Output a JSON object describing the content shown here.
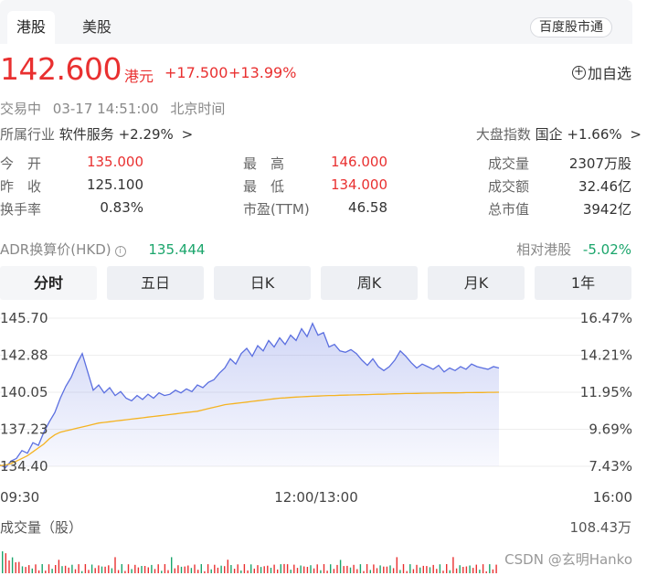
{
  "tabs": {
    "hk": "港股",
    "us": "美股",
    "market_link": "百度股市通"
  },
  "quote": {
    "price": "142.600",
    "currency": "港元",
    "change": "+17.500",
    "change_pct": "+13.99%",
    "add_watch": "加自选"
  },
  "status": {
    "state": "交易中",
    "time": "03-17 14:51:00",
    "tz": "北京时间"
  },
  "industry": {
    "label": "所属行业",
    "name": "软件服务",
    "change": "+2.29%",
    "chevron": ">"
  },
  "index": {
    "label": "大盘指数",
    "name": "国企",
    "change": "+1.66%",
    "chevron": ">"
  },
  "stats": {
    "open_label": "今　开",
    "open": "135.000",
    "prev_label": "昨　收",
    "prev": "125.100",
    "turnover_label": "换手率",
    "turnover": "0.83%",
    "high_label": "最　高",
    "high": "146.000",
    "low_label": "最　低",
    "low": "134.000",
    "pe_label": "市盈(TTM)",
    "pe": "46.58",
    "vol_label": "成交量",
    "vol": "2307万股",
    "amt_label": "成交额",
    "amt": "32.46亿",
    "cap_label": "总市值",
    "cap": "3942亿"
  },
  "adr": {
    "label": "ADR换算价(HKD)",
    "value": "135.444",
    "rel_label": "相对港股",
    "rel_value": "-5.02%"
  },
  "periods": [
    "分时",
    "五日",
    "日K",
    "周K",
    "月K",
    "1年"
  ],
  "colors": {
    "up": "#e93030",
    "down": "#1aa56b",
    "price_line": "#5b6fe0",
    "avg_line": "#f5b321"
  },
  "chart_data": {
    "type": "area",
    "y_left_ticks": [
      "145.70",
      "142.88",
      "140.05",
      "137.23",
      "134.40"
    ],
    "y_right_ticks": [
      "16.47%",
      "14.21%",
      "11.95%",
      "9.69%",
      "7.43%"
    ],
    "x_ticks": [
      "09:30",
      "12:00/13:00",
      "16:00"
    ],
    "ylim": [
      134.4,
      145.7
    ],
    "series": [
      {
        "values": [
          134.5,
          134.3,
          134.8,
          135.0,
          135.6,
          135.4,
          136.2,
          136.0,
          137.0,
          137.8,
          138.5,
          139.6,
          140.5,
          141.2,
          142.2,
          143.0,
          141.6,
          140.2,
          140.6,
          140.0,
          140.4,
          139.8,
          140.1,
          139.6,
          139.4,
          139.8,
          139.5,
          139.9,
          139.6,
          140.0,
          139.8,
          139.9,
          140.2,
          140.0,
          140.3,
          140.1,
          140.6,
          140.4,
          140.8,
          141.0,
          141.5,
          141.9,
          142.6,
          142.2,
          143.0,
          143.4,
          142.8,
          143.6,
          143.2,
          144.0,
          143.5,
          144.2,
          143.7,
          144.4,
          144.0,
          144.9,
          144.3,
          145.3,
          144.4,
          144.6,
          143.5,
          143.7,
          143.2,
          143.1,
          143.3,
          143.0,
          142.5,
          142.1,
          142.6,
          142.0,
          141.7,
          142.0,
          142.5,
          143.2,
          142.8,
          142.3,
          141.9,
          142.2,
          142.0,
          141.8,
          142.1,
          141.6,
          141.9,
          141.7,
          142.0,
          141.8,
          142.2,
          142.0,
          141.9,
          141.8,
          142.0,
          141.9
        ],
        "name": ""
      },
      {
        "values": [
          134.45,
          134.5,
          134.6,
          134.8,
          135.0,
          135.2,
          135.5,
          135.8,
          136.1,
          136.5,
          136.8,
          137.0,
          137.1,
          137.2,
          137.3,
          137.4,
          137.5,
          137.6,
          137.7,
          137.75,
          137.8,
          137.85,
          137.9,
          137.95,
          138.0,
          138.05,
          138.1,
          138.15,
          138.2,
          138.25,
          138.3,
          138.35,
          138.4,
          138.45,
          138.5,
          138.55,
          138.6,
          138.7,
          138.8,
          138.9,
          139.0,
          139.1,
          139.15,
          139.2,
          139.25,
          139.3,
          139.35,
          139.4,
          139.45,
          139.5,
          139.55,
          139.6,
          139.62,
          139.65,
          139.68,
          139.7,
          139.72,
          139.74,
          139.76,
          139.78,
          139.8,
          139.8,
          139.82,
          139.83,
          139.84,
          139.85,
          139.86,
          139.87,
          139.88,
          139.9,
          139.9,
          139.92,
          139.93,
          139.94,
          139.95,
          139.95,
          139.96,
          139.97,
          139.98,
          139.98,
          139.99,
          140.0,
          140.0,
          140.0,
          140.01,
          140.02,
          140.02,
          140.03,
          140.03,
          140.04,
          140.04,
          140.05
        ],
        "name": ""
      }
    ],
    "volume": {
      "label": "成交量（股）",
      "max": "108.43万"
    }
  },
  "watermark": "CSDN @玄明Hanko"
}
